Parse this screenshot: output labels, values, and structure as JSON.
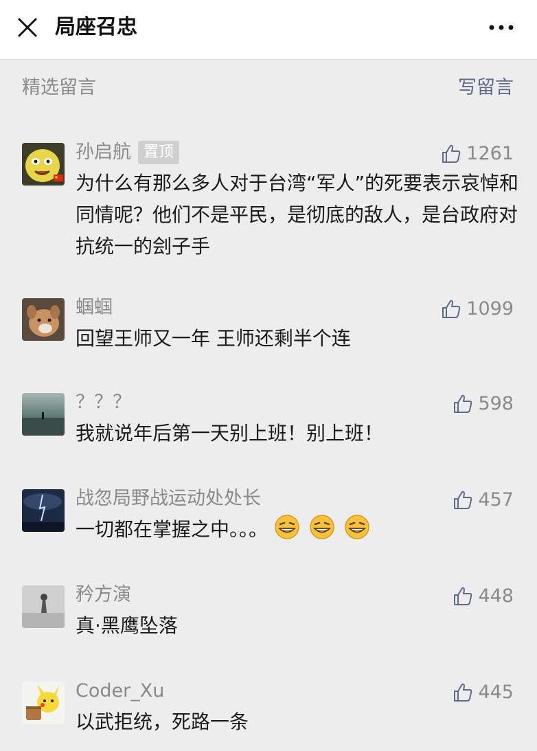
{
  "header": {
    "title": "局座召忠",
    "close_icon": "close-icon",
    "more_icon": "more-horizontal-icon"
  },
  "section": {
    "label": "精选留言",
    "write_label": "写留言"
  },
  "colors": {
    "background": "#ededed",
    "nickname": "#8a8a8a",
    "link": "#5d6a8a",
    "body_text": "#1a1a1a",
    "pin_badge_bg": "#cfcfcf"
  },
  "comments": [
    {
      "name": "孙启航",
      "badge": "置顶",
      "likes": "1261",
      "text": "为什么有那么多人对于台湾“军人”的死要表示哀悼和同情呢？他们不是平民，是彻底的敌人，是台政府对抗统一的刽子手",
      "avatar_icon": "yellow-cartoon-avatar"
    },
    {
      "name": "蝈蝈",
      "likes": "1099",
      "text": "回望王师又一年 王师还剩半个连",
      "avatar_icon": "dog-photo-avatar"
    },
    {
      "name": "？？？",
      "likes": "598",
      "text": "我就说年后第一天别上班！别上班！",
      "avatar_icon": "landscape-photo-avatar"
    },
    {
      "name": "战忽局野战运动处处长",
      "likes": "457",
      "text": "一切都在掌握之中。。。",
      "emoji_icon": "grinning-emoji-icon",
      "emoji_count": 3,
      "avatar_icon": "night-storm-avatar"
    },
    {
      "name": "矜方演",
      "likes": "448",
      "text": "真·黑鹰坠落",
      "avatar_icon": "grey-photo-avatar"
    },
    {
      "name": "Coder_Xu",
      "likes": "445",
      "text": "以武拒统，死路一条",
      "avatar_icon": "pikachu-avatar"
    }
  ],
  "like_icon": "thumbs-up-icon"
}
